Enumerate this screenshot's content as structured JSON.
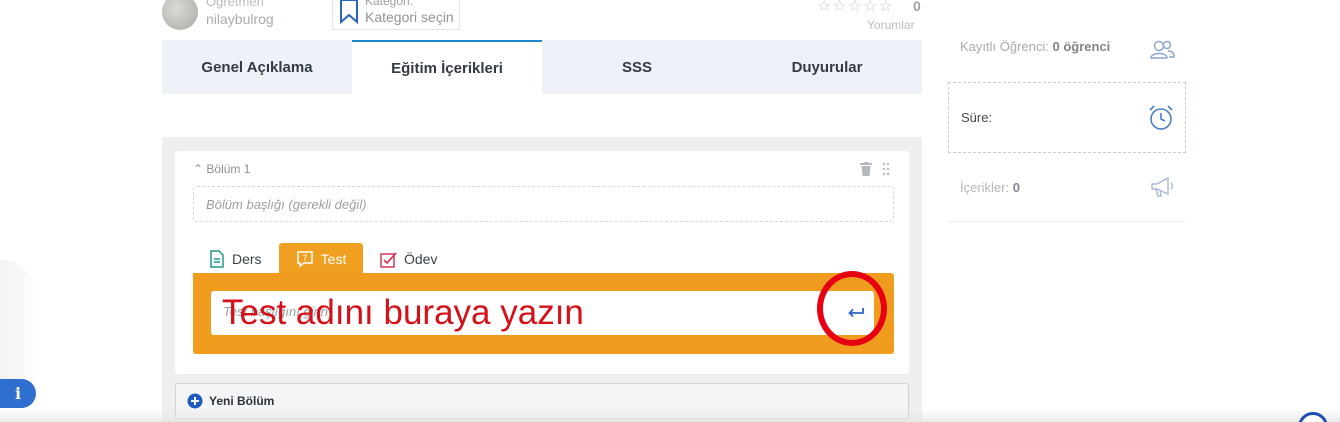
{
  "header": {
    "teacher_role": "Öğretmen",
    "teacher_name": "nilaybulrog",
    "category_label": "Kategori:",
    "category_value": "Kategori seçin",
    "stars": "☆☆☆☆☆",
    "rating_count": "0",
    "reviews_label": "Yorumlar"
  },
  "tabs": [
    {
      "label": "Genel Açıklama"
    },
    {
      "label": "Eğitim İçerikleri"
    },
    {
      "label": "SSS"
    },
    {
      "label": "Duyurular"
    }
  ],
  "section": {
    "title": "Bölüm 1",
    "title_placeholder": "Bölüm başlığı (gerekli değil)",
    "content_tabs": [
      {
        "label": "Ders"
      },
      {
        "label": "Test"
      },
      {
        "label": "Ödev"
      }
    ],
    "test_placeholder": "Test başlığını girin",
    "overlay_annotation": "Test adını buraya yazın"
  },
  "new_section_label": "Yeni Bölüm",
  "sidebar": {
    "students_label": "Kayıtlı Öğrenci:",
    "students_value": "0 öğrenci",
    "duration_label": "Süre:",
    "contents_label": "İçerikler:",
    "contents_value": "0"
  },
  "colors": {
    "accent_orange": "#f09c1e",
    "tab_active_border": "#1e88c8",
    "annotation_red": "#e60012",
    "info_blue": "#2f6fd0"
  },
  "icons": {
    "info": "i"
  }
}
